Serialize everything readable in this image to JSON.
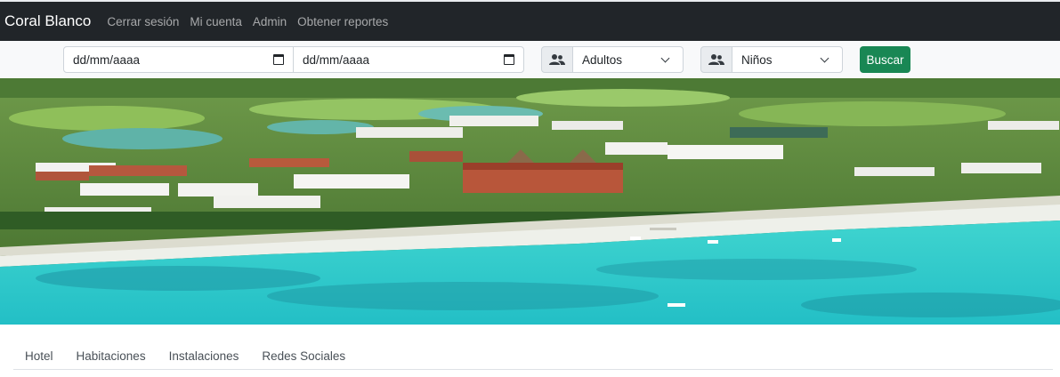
{
  "navbar": {
    "brand": "Coral Blanco",
    "links": [
      "Cerrar sesión",
      "Mi cuenta",
      "Admin",
      "Obtener reportes"
    ]
  },
  "search": {
    "checkin_placeholder": "dd/mm/aaaa",
    "checkout_placeholder": "dd/mm/aaaa",
    "adults_selected": "Adultos",
    "children_selected": "Niños",
    "button_label": "Buscar",
    "button_color": "#198754"
  },
  "hero": {
    "icon": "resort-beach-aerial-image"
  },
  "tabs": [
    "Hotel",
    "Habitaciones",
    "Instalaciones",
    "Redes Sociales"
  ],
  "colors": {
    "navbar_bg": "#212529",
    "sea": "#2fc9c9",
    "beach": "#eef0ea",
    "vegetation": "#4a7a32"
  }
}
